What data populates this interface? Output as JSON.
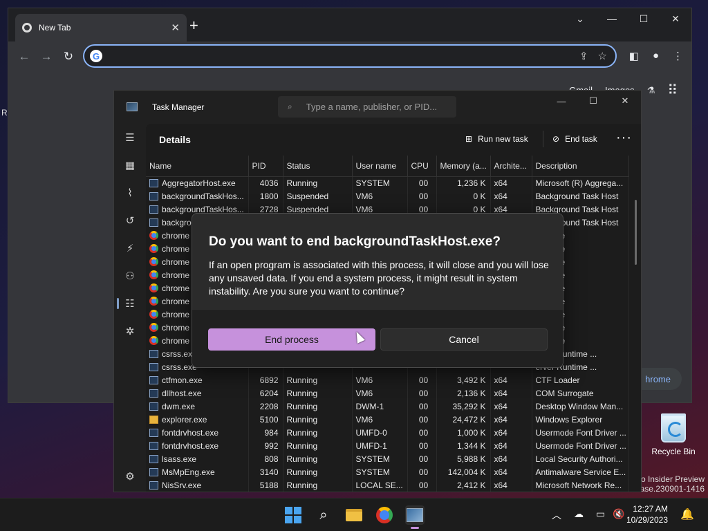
{
  "desktop": {
    "left_edge_text": "Re",
    "recycle_bin_label": "Recycle Bin",
    "watermark_line1": "ro Insider Preview",
    "watermark_line2": "lease.230901-1416"
  },
  "chrome": {
    "tab_title": "New Tab",
    "tab_close": "✕",
    "new_tab": "+",
    "back_icon": "←",
    "forward_icon": "→",
    "reload_icon": "↻",
    "omnibox_value": "",
    "omnibox_g": "G",
    "links": {
      "gmail": "Gmail",
      "images": "Images"
    },
    "customize_label": "hrome",
    "win_min": "—",
    "win_max": "☐",
    "win_close": "✕",
    "tab_search_icon": "⌄"
  },
  "task_manager": {
    "title": "Task Manager",
    "search_placeholder": "Type a name, publisher, or PID...",
    "page_title": "Details",
    "run_new_task": "Run new task",
    "end_task": "End task",
    "more": "···",
    "columns": [
      "Name",
      "PID",
      "Status",
      "User name",
      "CPU",
      "Memory (a...",
      "Archite...",
      "Description"
    ],
    "rows": [
      {
        "icon": "app",
        "name": "AggregatorHost.exe",
        "pid": "4036",
        "status": "Running",
        "user": "SYSTEM",
        "cpu": "00",
        "mem": "1,236 K",
        "arch": "x64",
        "desc": "Microsoft (R) Aggrega..."
      },
      {
        "icon": "app",
        "name": "backgroundTaskHos...",
        "pid": "1800",
        "status": "Suspended",
        "user": "VM6",
        "cpu": "00",
        "mem": "0 K",
        "arch": "x64",
        "desc": "Background Task Host"
      },
      {
        "icon": "app",
        "name": "backgroundTaskHos...",
        "pid": "2728",
        "status": "Suspended",
        "user": "VM6",
        "cpu": "00",
        "mem": "0 K",
        "arch": "x64",
        "desc": "Background Task Host"
      },
      {
        "icon": "app",
        "name": "backgro",
        "pid": "",
        "status": "",
        "user": "",
        "cpu": "",
        "mem": "",
        "arch": "",
        "desc": "Background Task Host"
      },
      {
        "icon": "chrome",
        "name": "chrome",
        "pid": "",
        "status": "",
        "user": "",
        "cpu": "",
        "mem": "",
        "arch": "",
        "desc": "Chrome"
      },
      {
        "icon": "chrome",
        "name": "chrome",
        "pid": "",
        "status": "",
        "user": "",
        "cpu": "",
        "mem": "",
        "arch": "",
        "desc": "Chrome"
      },
      {
        "icon": "chrome",
        "name": "chrome",
        "pid": "",
        "status": "",
        "user": "",
        "cpu": "",
        "mem": "",
        "arch": "",
        "desc": "Chrome"
      },
      {
        "icon": "chrome",
        "name": "chrome",
        "pid": "",
        "status": "",
        "user": "",
        "cpu": "",
        "mem": "",
        "arch": "",
        "desc": "Chrome"
      },
      {
        "icon": "chrome",
        "name": "chrome",
        "pid": "",
        "status": "",
        "user": "",
        "cpu": "",
        "mem": "",
        "arch": "",
        "desc": "Chrome"
      },
      {
        "icon": "chrome",
        "name": "chrome",
        "pid": "",
        "status": "",
        "user": "",
        "cpu": "",
        "mem": "",
        "arch": "",
        "desc": "Chrome"
      },
      {
        "icon": "chrome",
        "name": "chrome",
        "pid": "",
        "status": "",
        "user": "",
        "cpu": "",
        "mem": "",
        "arch": "",
        "desc": "Chrome"
      },
      {
        "icon": "chrome",
        "name": "chrome",
        "pid": "",
        "status": "",
        "user": "",
        "cpu": "",
        "mem": "",
        "arch": "",
        "desc": "Chrome"
      },
      {
        "icon": "chrome",
        "name": "chrome",
        "pid": "",
        "status": "",
        "user": "",
        "cpu": "",
        "mem": "",
        "arch": "",
        "desc": "Chrome"
      },
      {
        "icon": "app",
        "name": "csrss.exe",
        "pid": "",
        "status": "",
        "user": "",
        "cpu": "",
        "mem": "",
        "arch": "",
        "desc": "erver Runtime ..."
      },
      {
        "icon": "app",
        "name": "csrss.exe",
        "pid": "",
        "status": "",
        "user": "",
        "cpu": "",
        "mem": "",
        "arch": "",
        "desc": "erver Runtime ..."
      },
      {
        "icon": "app",
        "name": "ctfmon.exe",
        "pid": "6892",
        "status": "Running",
        "user": "VM6",
        "cpu": "00",
        "mem": "3,492 K",
        "arch": "x64",
        "desc": "CTF Loader"
      },
      {
        "icon": "app",
        "name": "dllhost.exe",
        "pid": "6204",
        "status": "Running",
        "user": "VM6",
        "cpu": "00",
        "mem": "2,136 K",
        "arch": "x64",
        "desc": "COM Surrogate"
      },
      {
        "icon": "app",
        "name": "dwm.exe",
        "pid": "2208",
        "status": "Running",
        "user": "DWM-1",
        "cpu": "00",
        "mem": "35,292 K",
        "arch": "x64",
        "desc": "Desktop Window Man..."
      },
      {
        "icon": "folder",
        "name": "explorer.exe",
        "pid": "5100",
        "status": "Running",
        "user": "VM6",
        "cpu": "00",
        "mem": "24,472 K",
        "arch": "x64",
        "desc": "Windows Explorer"
      },
      {
        "icon": "app",
        "name": "fontdrvhost.exe",
        "pid": "984",
        "status": "Running",
        "user": "UMFD-0",
        "cpu": "00",
        "mem": "1,000 K",
        "arch": "x64",
        "desc": "Usermode Font Driver ..."
      },
      {
        "icon": "app",
        "name": "fontdrvhost.exe",
        "pid": "992",
        "status": "Running",
        "user": "UMFD-1",
        "cpu": "00",
        "mem": "1,344 K",
        "arch": "x64",
        "desc": "Usermode Font Driver ..."
      },
      {
        "icon": "app",
        "name": "lsass.exe",
        "pid": "808",
        "status": "Running",
        "user": "SYSTEM",
        "cpu": "00",
        "mem": "5,988 K",
        "arch": "x64",
        "desc": "Local Security Authori..."
      },
      {
        "icon": "app",
        "name": "MsMpEng.exe",
        "pid": "3140",
        "status": "Running",
        "user": "SYSTEM",
        "cpu": "00",
        "mem": "142,004 K",
        "arch": "x64",
        "desc": "Antimalware Service E..."
      },
      {
        "icon": "app",
        "name": "NisSrv.exe",
        "pid": "5188",
        "status": "Running",
        "user": "LOCAL SE...",
        "cpu": "00",
        "mem": "2,412 K",
        "arch": "x64",
        "desc": "Microsoft Network Re..."
      }
    ]
  },
  "dialog": {
    "title": "Do you want to end backgroundTaskHost.exe?",
    "body": "If an open program is associated with this process, it will close and you will lose any unsaved data. If you end a system process, it might result in system instability. Are you sure you want to continue?",
    "primary": "End process",
    "secondary": "Cancel"
  },
  "taskbar": {
    "time": "12:27 AM",
    "date": "10/29/2023",
    "accent_color": "#c691dc"
  }
}
